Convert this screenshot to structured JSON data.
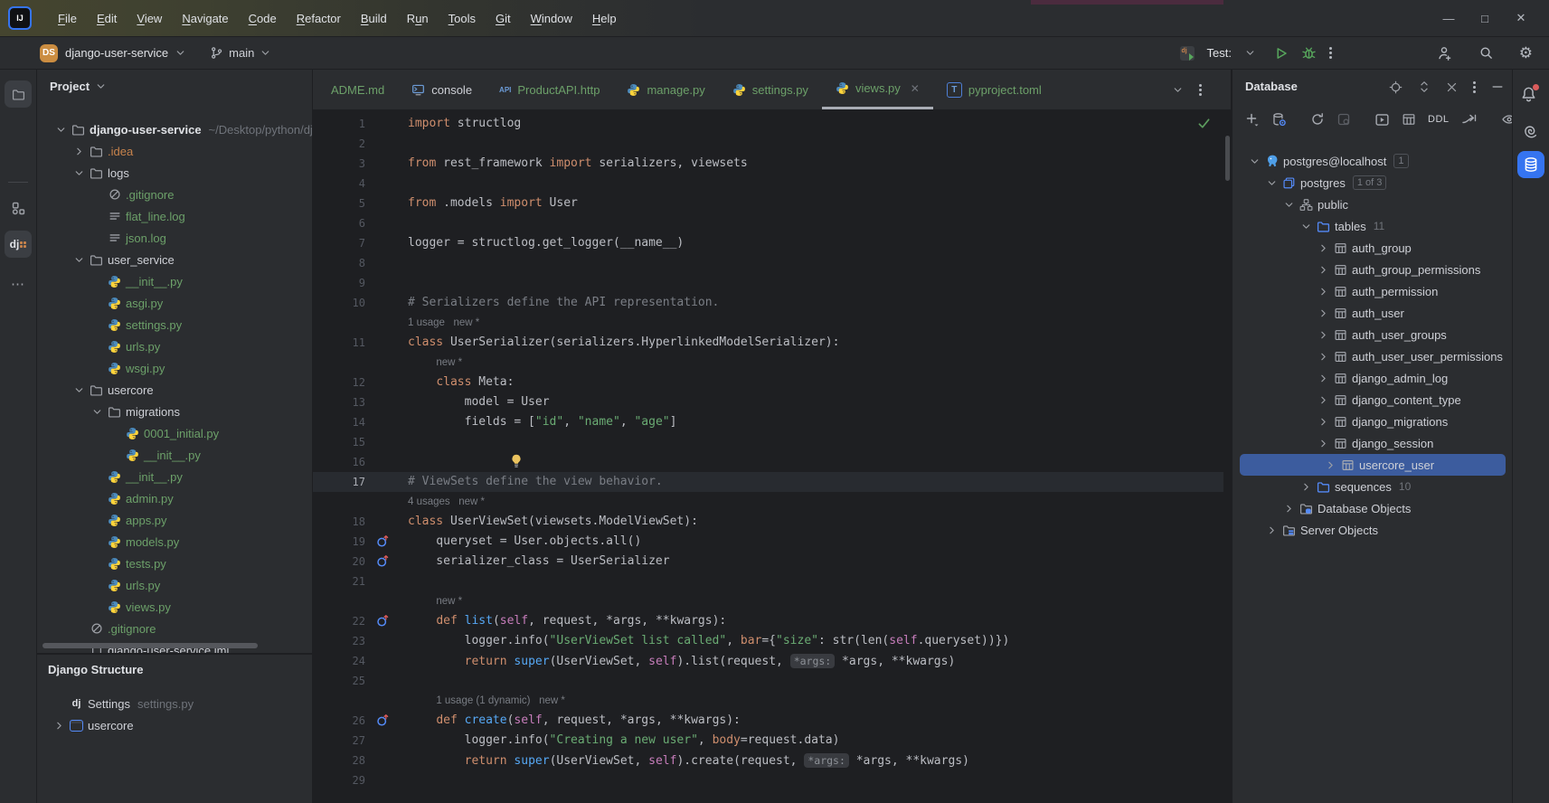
{
  "window": {
    "logo": "IJ",
    "menu_items": [
      {
        "label": "File",
        "u": 0
      },
      {
        "label": "Edit",
        "u": 0
      },
      {
        "label": "View",
        "u": 0
      },
      {
        "label": "Navigate",
        "u": 0
      },
      {
        "label": "Code",
        "u": 0
      },
      {
        "label": "Refactor",
        "u": 0
      },
      {
        "label": "Build",
        "u": 0
      },
      {
        "label": "Run",
        "u": 1
      },
      {
        "label": "Tools",
        "u": 0
      },
      {
        "label": "Git",
        "u": 0
      },
      {
        "label": "Window",
        "u": 0
      },
      {
        "label": "Help",
        "u": 0
      }
    ],
    "controls": [
      {
        "name": "minimize",
        "glyph": "—"
      },
      {
        "name": "maximize",
        "glyph": "□"
      },
      {
        "name": "close",
        "glyph": "✕"
      }
    ]
  },
  "toolbar": {
    "project_badge": "DS",
    "project_name": "django-user-service",
    "branch_name": "main",
    "run_config_label": "Test:"
  },
  "left_strip": {
    "items": [
      {
        "icon": "folder",
        "name": "project"
      },
      {
        "icon": "structure",
        "name": "structure"
      },
      {
        "icon": "dj",
        "name": "django-structure"
      },
      {
        "icon": "more",
        "name": "more-tool-windows"
      }
    ]
  },
  "project_panel": {
    "title": "Project",
    "tree": [
      {
        "d": 0,
        "c": "down",
        "i": "folder",
        "t": "django-user-service",
        "cls": "bold",
        "path": "~/Desktop/python/django"
      },
      {
        "d": 1,
        "c": "right",
        "i": "folder",
        "t": ".idea",
        "cls": "o"
      },
      {
        "d": 1,
        "c": "down",
        "i": "folder",
        "t": "logs",
        "cls": "w"
      },
      {
        "d": 2,
        "c": null,
        "i": "ignored",
        "t": ".gitignore",
        "cls": "g"
      },
      {
        "d": 2,
        "c": null,
        "i": "loglines",
        "t": "flat_line.log",
        "cls": "g"
      },
      {
        "d": 2,
        "c": null,
        "i": "loglines",
        "t": "json.log",
        "cls": "g"
      },
      {
        "d": 1,
        "c": "down",
        "i": "folder",
        "t": "user_service",
        "cls": "w"
      },
      {
        "d": 2,
        "c": null,
        "i": "python",
        "t": "__init__.py",
        "cls": "g"
      },
      {
        "d": 2,
        "c": null,
        "i": "python",
        "t": "asgi.py",
        "cls": "g"
      },
      {
        "d": 2,
        "c": null,
        "i": "python",
        "t": "settings.py",
        "cls": "g"
      },
      {
        "d": 2,
        "c": null,
        "i": "python",
        "t": "urls.py",
        "cls": "g"
      },
      {
        "d": 2,
        "c": null,
        "i": "python",
        "t": "wsgi.py",
        "cls": "g"
      },
      {
        "d": 1,
        "c": "down",
        "i": "folder",
        "t": "usercore",
        "cls": "w"
      },
      {
        "d": 2,
        "c": "down",
        "i": "folder",
        "t": "migrations",
        "cls": "w"
      },
      {
        "d": 3,
        "c": null,
        "i": "python",
        "t": "0001_initial.py",
        "cls": "g"
      },
      {
        "d": 3,
        "c": null,
        "i": "python",
        "t": "__init__.py",
        "cls": "g"
      },
      {
        "d": 2,
        "c": null,
        "i": "python",
        "t": "__init__.py",
        "cls": "g"
      },
      {
        "d": 2,
        "c": null,
        "i": "python",
        "t": "admin.py",
        "cls": "g"
      },
      {
        "d": 2,
        "c": null,
        "i": "python",
        "t": "apps.py",
        "cls": "g"
      },
      {
        "d": 2,
        "c": null,
        "i": "python",
        "t": "models.py",
        "cls": "g"
      },
      {
        "d": 2,
        "c": null,
        "i": "python",
        "t": "tests.py",
        "cls": "g"
      },
      {
        "d": 2,
        "c": null,
        "i": "python",
        "t": "urls.py",
        "cls": "g"
      },
      {
        "d": 2,
        "c": null,
        "i": "python",
        "t": "views.py",
        "cls": "g"
      },
      {
        "d": 1,
        "c": null,
        "i": "ignored",
        "t": ".gitignore",
        "cls": "g"
      },
      {
        "d": 1,
        "c": null,
        "i": "module",
        "t": "django-user-service.iml",
        "cls": "w"
      }
    ]
  },
  "structure_panel": {
    "title": "Django Structure",
    "items": [
      {
        "c": null,
        "i": "dj",
        "t": "Settings",
        "cls": "w",
        "extra": "settings.py"
      },
      {
        "c": "right",
        "i": "appbox",
        "t": "usercore",
        "cls": "w",
        "extra": ""
      }
    ]
  },
  "tabs": {
    "items": [
      {
        "label": "ADME.md",
        "icon": null,
        "cls": "g",
        "active": false
      },
      {
        "label": "console",
        "icon": "console",
        "cls": "w",
        "active": false
      },
      {
        "label": "ProductAPI.http",
        "icon": "api",
        "cls": "g",
        "active": false
      },
      {
        "label": "manage.py",
        "icon": "python",
        "cls": "g",
        "active": false
      },
      {
        "label": "settings.py",
        "icon": "python",
        "cls": "g",
        "active": false
      },
      {
        "label": "views.py",
        "icon": "python",
        "cls": "g",
        "active": true,
        "close": "✕"
      },
      {
        "label": "pyproject.toml",
        "icon": "toml",
        "cls": "g",
        "active": false
      }
    ]
  },
  "editor": {
    "file": "views.py",
    "lines": [
      {
        "n": "1",
        "tokens": [
          [
            "kw",
            "import"
          ],
          [
            "df",
            " structlog"
          ]
        ]
      },
      {
        "n": "2",
        "tokens": []
      },
      {
        "n": "3",
        "tokens": [
          [
            "kw",
            "from"
          ],
          [
            "df",
            " rest_framework "
          ],
          [
            "kw",
            "import"
          ],
          [
            "df",
            " serializers, viewsets"
          ]
        ]
      },
      {
        "n": "4",
        "tokens": []
      },
      {
        "n": "5",
        "tokens": [
          [
            "kw",
            "from"
          ],
          [
            "df",
            " .models "
          ],
          [
            "kw",
            "import"
          ],
          [
            "df",
            " User"
          ]
        ]
      },
      {
        "n": "6",
        "tokens": []
      },
      {
        "n": "7",
        "tokens": [
          [
            "df",
            "logger = structlog.get_logger(__name__)"
          ]
        ]
      },
      {
        "n": "8",
        "tokens": []
      },
      {
        "n": "9",
        "tokens": []
      },
      {
        "n": "10",
        "tokens": [
          [
            "cm",
            "# Serializers define the API representation."
          ]
        ]
      },
      {
        "inlay": "1 usage   new *",
        "ind": 0
      },
      {
        "n": "11",
        "tokens": [
          [
            "kw",
            "class"
          ],
          [
            "df",
            " UserSerializer(serializers.HyperlinkedModelSerializer):"
          ]
        ]
      },
      {
        "inlay": "new *",
        "ind": 4
      },
      {
        "n": "12",
        "tokens": [
          [
            "df",
            "    "
          ],
          [
            "kw",
            "class"
          ],
          [
            "df",
            " Meta:"
          ]
        ]
      },
      {
        "n": "13",
        "tokens": [
          [
            "df",
            "        model = User"
          ]
        ]
      },
      {
        "n": "14",
        "tokens": [
          [
            "df",
            "        fields = ["
          ],
          [
            "str",
            "\"id\""
          ],
          [
            "df",
            ", "
          ],
          [
            "str",
            "\"name\""
          ],
          [
            "df",
            ", "
          ],
          [
            "str",
            "\"age\""
          ],
          [
            "df",
            "]"
          ]
        ]
      },
      {
        "n": "15",
        "tokens": []
      },
      {
        "n": "16",
        "tokens": [],
        "bulb": true
      },
      {
        "n": "17",
        "tokens": [
          [
            "cm",
            "# ViewSets define the view behavior."
          ]
        ],
        "current": true
      },
      {
        "inlay": "4 usages   new *",
        "ind": 0
      },
      {
        "n": "18",
        "tokens": [
          [
            "kw",
            "class"
          ],
          [
            "df",
            " UserViewSet(viewsets.ModelViewSet):"
          ]
        ]
      },
      {
        "n": "19",
        "tokens": [
          [
            "df",
            "    queryset = User.objects.all()"
          ]
        ],
        "gutter": "override"
      },
      {
        "n": "20",
        "tokens": [
          [
            "df",
            "    serializer_class = UserSerializer"
          ]
        ],
        "gutter": "override"
      },
      {
        "n": "21",
        "tokens": []
      },
      {
        "inlay": "new *",
        "ind": 4
      },
      {
        "n": "22",
        "tokens": [
          [
            "df",
            "    "
          ],
          [
            "kw",
            "def"
          ],
          [
            "df",
            " "
          ],
          [
            "fn",
            "list"
          ],
          [
            "df",
            "("
          ],
          [
            "sf",
            "self"
          ],
          [
            "df",
            ", request, *args, **kwargs):"
          ]
        ],
        "gutter": "override"
      },
      {
        "n": "23",
        "tokens": [
          [
            "df",
            "        logger.info("
          ],
          [
            "str",
            "\"UserViewSet list called\""
          ],
          [
            "df",
            ", "
          ],
          [
            "na",
            "bar"
          ],
          [
            "df",
            "={"
          ],
          [
            "str",
            "\"size\""
          ],
          [
            "df",
            ": str(len("
          ],
          [
            "sf",
            "self"
          ],
          [
            "df",
            ".queryset))})"
          ]
        ]
      },
      {
        "n": "24",
        "tokens": [
          [
            "df",
            "        "
          ],
          [
            "kw",
            "return"
          ],
          [
            "df",
            " "
          ],
          [
            "fn",
            "super"
          ],
          [
            "df",
            "(UserViewSet, "
          ],
          [
            "sf",
            "self"
          ],
          [
            "df",
            ").list(request, "
          ],
          [
            "chip",
            "*args:"
          ],
          [
            "df",
            " *args, **kwargs)"
          ]
        ]
      },
      {
        "n": "25",
        "tokens": []
      },
      {
        "inlay": "1 usage (1 dynamic)   new *",
        "ind": 4
      },
      {
        "n": "26",
        "tokens": [
          [
            "df",
            "    "
          ],
          [
            "kw",
            "def"
          ],
          [
            "df",
            " "
          ],
          [
            "fn",
            "create"
          ],
          [
            "df",
            "("
          ],
          [
            "sf",
            "self"
          ],
          [
            "df",
            ", request, *args, **kwargs):"
          ]
        ],
        "gutter": "override"
      },
      {
        "n": "27",
        "tokens": [
          [
            "df",
            "        logger.info("
          ],
          [
            "str",
            "\"Creating a new user\""
          ],
          [
            "df",
            ", "
          ],
          [
            "na",
            "body"
          ],
          [
            "df",
            "=request.data)"
          ]
        ]
      },
      {
        "n": "28",
        "tokens": [
          [
            "df",
            "        "
          ],
          [
            "kw",
            "return"
          ],
          [
            "df",
            " "
          ],
          [
            "fn",
            "super"
          ],
          [
            "df",
            "(UserViewSet, "
          ],
          [
            "sf",
            "self"
          ],
          [
            "df",
            ").create(request, "
          ],
          [
            "chip",
            "*args:"
          ],
          [
            "df",
            " *args, **kwargs)"
          ]
        ]
      },
      {
        "n": "29",
        "tokens": []
      }
    ]
  },
  "database_panel": {
    "title": "Database",
    "header_icons": [
      "locate",
      "expand",
      "collapse-all",
      "more",
      "hide"
    ],
    "toolbar_icons": [
      "add",
      "data-source-properties",
      "div",
      "refresh",
      "cancel",
      "div",
      "jump-console",
      "open-table",
      "ddl",
      "navigate",
      "div",
      "eye"
    ],
    "ddl_label": "DDL",
    "tree": [
      {
        "d": 0,
        "c": "down",
        "i": "elephant",
        "t": "postgres@localhost",
        "cls": "w",
        "badge": "1"
      },
      {
        "d": 1,
        "c": "down",
        "i": "dbcopy",
        "t": "postgres",
        "cls": "w",
        "badge": "1 of 3"
      },
      {
        "d": 2,
        "c": "down",
        "i": "schema",
        "t": "public",
        "cls": "w"
      },
      {
        "d": 3,
        "c": "down",
        "i": "folderblue",
        "t": "tables",
        "cls": "w",
        "count": "11"
      },
      {
        "d": 4,
        "c": "right",
        "i": "table",
        "t": "auth_group",
        "cls": "w"
      },
      {
        "d": 4,
        "c": "right",
        "i": "table",
        "t": "auth_group_permissions",
        "cls": "w"
      },
      {
        "d": 4,
        "c": "right",
        "i": "table",
        "t": "auth_permission",
        "cls": "w"
      },
      {
        "d": 4,
        "c": "right",
        "i": "table",
        "t": "auth_user",
        "cls": "w"
      },
      {
        "d": 4,
        "c": "right",
        "i": "table",
        "t": "auth_user_groups",
        "cls": "w"
      },
      {
        "d": 4,
        "c": "right",
        "i": "table",
        "t": "auth_user_user_permissions",
        "cls": "w"
      },
      {
        "d": 4,
        "c": "right",
        "i": "table",
        "t": "django_admin_log",
        "cls": "w"
      },
      {
        "d": 4,
        "c": "right",
        "i": "table",
        "t": "django_content_type",
        "cls": "w"
      },
      {
        "d": 4,
        "c": "right",
        "i": "table",
        "t": "django_migrations",
        "cls": "w"
      },
      {
        "d": 4,
        "c": "right",
        "i": "table",
        "t": "django_session",
        "cls": "w"
      },
      {
        "d": 4,
        "c": "right",
        "i": "table",
        "t": "usercore_user",
        "cls": "w",
        "sel": true
      },
      {
        "d": 3,
        "c": "right",
        "i": "folderblue",
        "t": "sequences",
        "cls": "w",
        "count": "10"
      },
      {
        "d": 2,
        "c": "right",
        "i": "folderdb",
        "t": "Database Objects",
        "cls": "w"
      },
      {
        "d": 1,
        "c": "right",
        "i": "foldersrv",
        "t": "Server Objects",
        "cls": "w"
      }
    ]
  },
  "right_strip": {
    "items": [
      {
        "icon": "bell",
        "name": "notifications"
      },
      {
        "icon": "ai",
        "name": "ai-assistant"
      },
      {
        "icon": "dbcyl",
        "name": "database-tool"
      }
    ]
  },
  "colors": {
    "accent": "#3574F0",
    "green": "#6CA069",
    "run_green": "#57A65C",
    "selection": "#3C5C9E",
    "added_orange": "#C7834C"
  }
}
